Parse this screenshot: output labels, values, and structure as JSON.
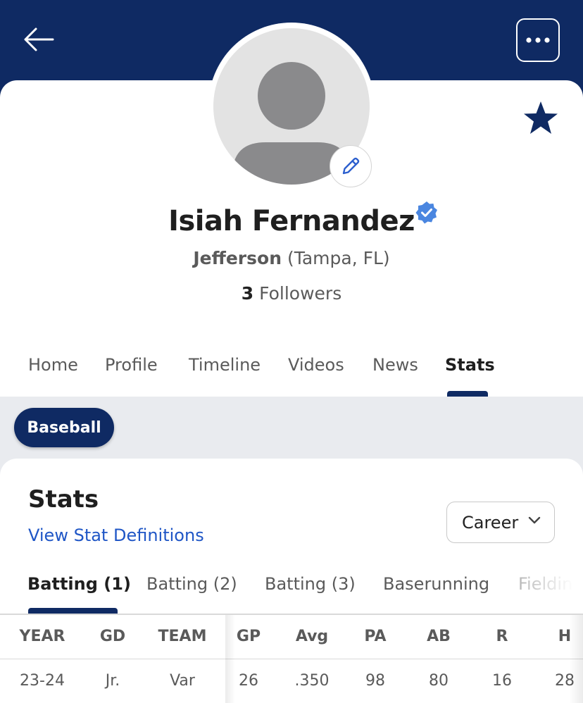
{
  "header": {
    "back_icon": "arrow-left-icon",
    "more_icon": "more-horizontal-icon",
    "brand_color": "#0f2a63"
  },
  "profile": {
    "name": "Isiah Fernandez",
    "verified_icon": "verified-badge-icon",
    "school": "Jefferson",
    "location": "(Tampa, FL)",
    "followers_count": "3",
    "followers_label": "Followers",
    "edit_icon": "pencil-icon",
    "favorite_icon": "star-icon"
  },
  "nav": {
    "tabs": [
      {
        "label": "Home"
      },
      {
        "label": "Profile"
      },
      {
        "label": "Timeline"
      },
      {
        "label": "Videos"
      },
      {
        "label": "News"
      },
      {
        "label": "Stats",
        "active": true
      }
    ]
  },
  "sport_filter": {
    "label": "Baseball"
  },
  "stats": {
    "title": "Stats",
    "definitions_link": "View Stat Definitions",
    "period_select": {
      "value": "Career",
      "icon": "chevron-down-icon"
    },
    "subtabs": [
      {
        "label": "Batting (1)",
        "active": true
      },
      {
        "label": "Batting (2)"
      },
      {
        "label": "Batting (3)"
      },
      {
        "label": "Baserunning"
      },
      {
        "label": "Fielding"
      }
    ],
    "table": {
      "columns": [
        "YEAR",
        "GD",
        "TEAM",
        "GP",
        "Avg",
        "PA",
        "AB",
        "R",
        "H"
      ],
      "rows": [
        [
          "23-24",
          "Jr.",
          "Var",
          "26",
          ".350",
          "98",
          "80",
          "16",
          "28"
        ]
      ]
    }
  }
}
